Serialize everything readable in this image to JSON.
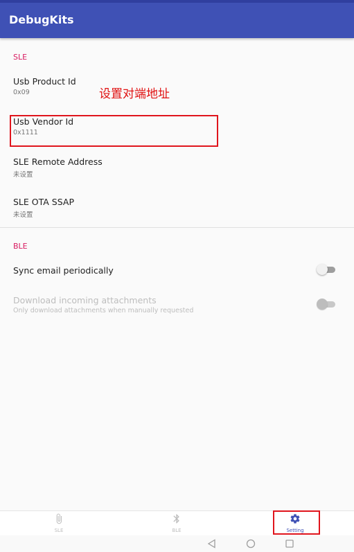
{
  "app": {
    "title": "DebugKits",
    "accent": "#3f51b5",
    "section_color": "#d81b60"
  },
  "sle_section": {
    "header": "SLE",
    "items": [
      {
        "title": "Usb Product Id",
        "summary": "0x09"
      },
      {
        "title": "Usb Vendor Id",
        "summary": "0x1111"
      },
      {
        "title": "SLE Remote Address",
        "summary": "未设置"
      },
      {
        "title": "SLE OTA SSAP",
        "summary": "未设置"
      }
    ]
  },
  "ble_section": {
    "header": "BLE",
    "items": [
      {
        "title": "Sync email periodically",
        "summary": "",
        "enabled": true,
        "checked": false
      },
      {
        "title": "Download incoming attachments",
        "summary": "Only download attachments when manually requested",
        "enabled": false,
        "checked": false
      }
    ]
  },
  "annotation": {
    "text": "设置对端地址",
    "color": "#e0141c"
  },
  "bottom_nav": {
    "items": [
      {
        "label": "SLE",
        "icon": "paperclip-icon",
        "active": false
      },
      {
        "label": "BLE",
        "icon": "bluetooth-icon",
        "active": false
      },
      {
        "label": "Setting",
        "icon": "gear-icon",
        "active": true
      }
    ]
  },
  "system_nav": {
    "icons": [
      "back-icon",
      "home-icon",
      "recents-icon"
    ]
  }
}
